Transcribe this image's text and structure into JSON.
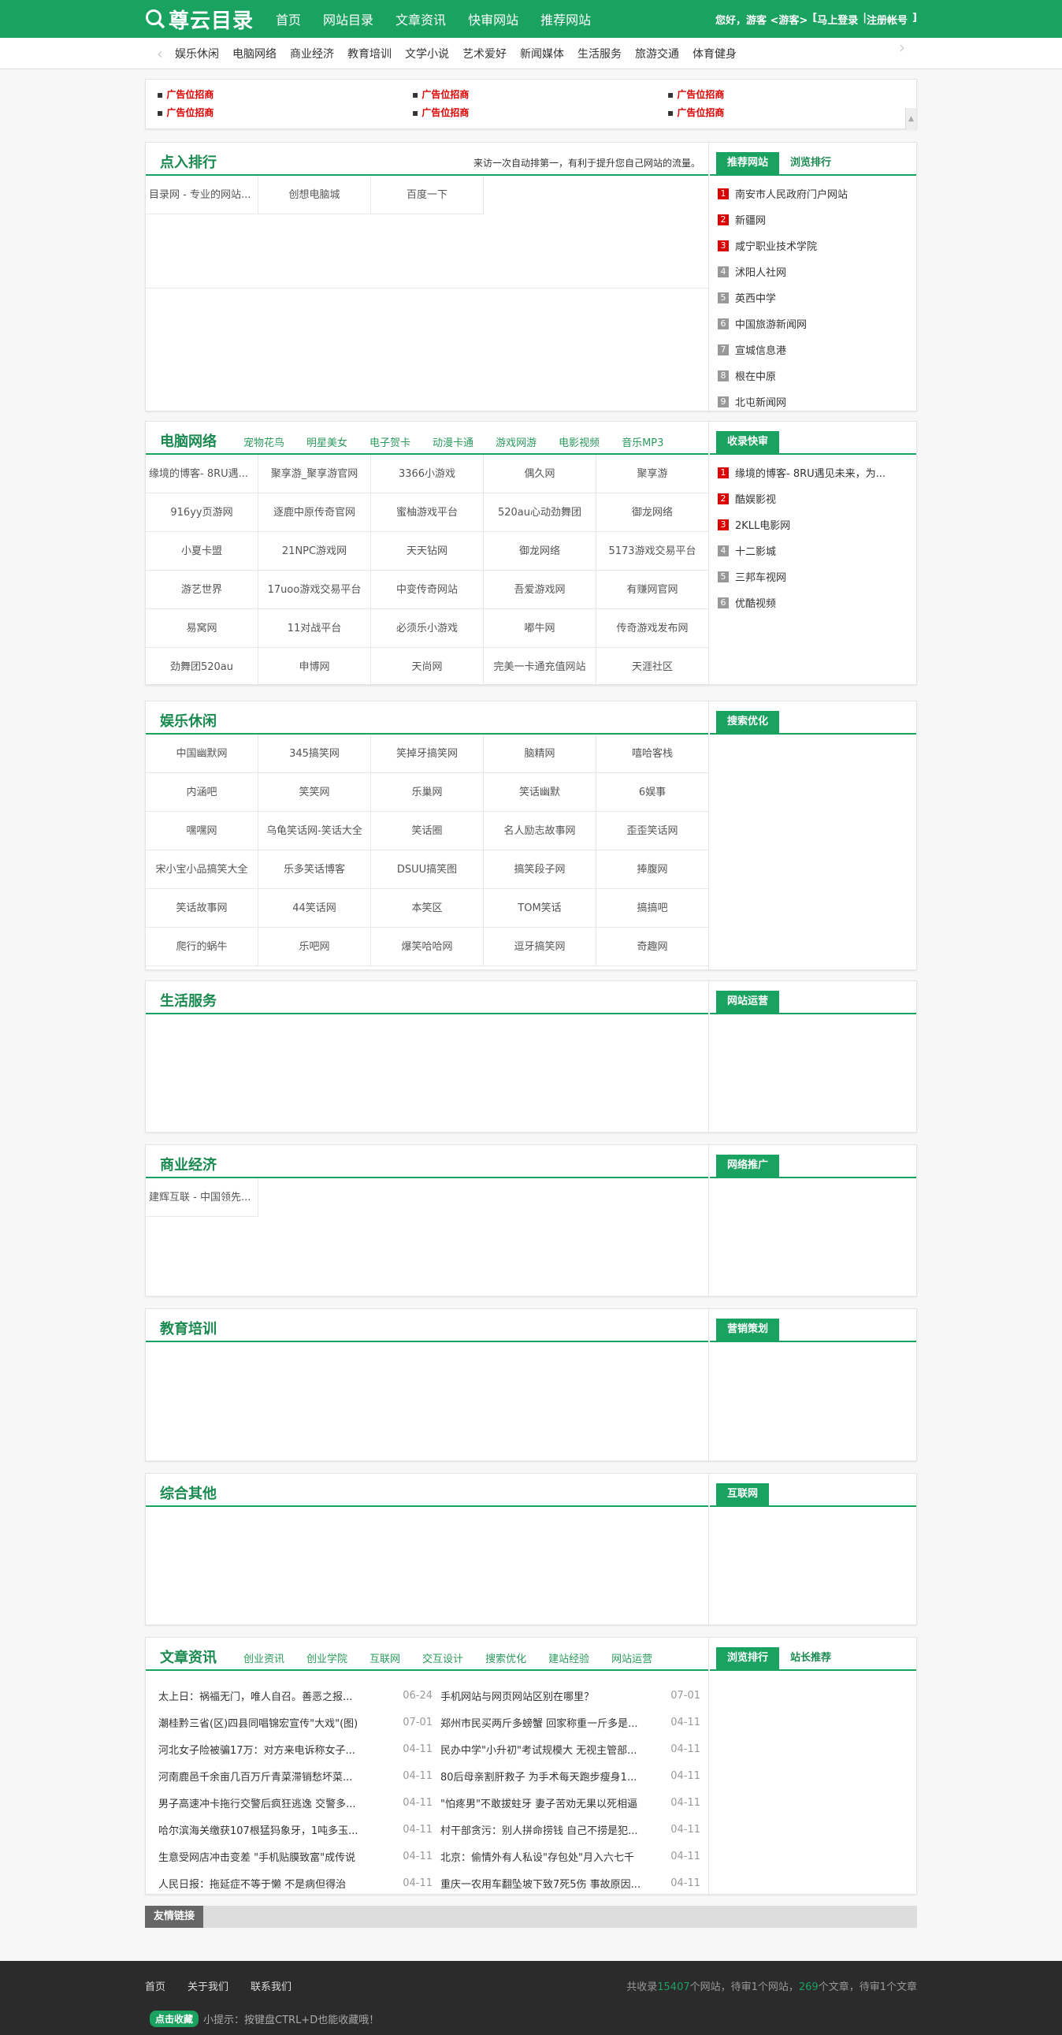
{
  "header": {
    "logo": "尊云目录",
    "nav": [
      "首页",
      "网站目录",
      "文章资讯",
      "快审网站",
      "推荐网站"
    ],
    "greeting": "您好，游客 <游客>",
    "login": "马上登录",
    "register": "注册帐号"
  },
  "subnav": [
    "娱乐休闲",
    "电脑网络",
    "商业经济",
    "教育培训",
    "文学小说",
    "艺术爱好",
    "新闻媒体",
    "生活服务",
    "旅游交通",
    "体育健身"
  ],
  "ads": [
    "广告位招商",
    "广告位招商",
    "广告位招商",
    "广告位招商",
    "广告位招商",
    "广告位招商"
  ],
  "dianru": {
    "title": "点入排行",
    "note": "来访一次自动排第一，有利于提升您自己网站的流量。",
    "sites": [
      "目录网 - 专业的网站...",
      "创想电脑城",
      "百度一下"
    ],
    "tabs": [
      "推荐网站",
      "浏览排行"
    ],
    "rank": [
      "南安市人民政府门户网站",
      "新疆网",
      "咸宁职业技术学院",
      "沭阳人社网",
      "英西中学",
      "中国旅游新闻网",
      "宣城信息港",
      "根在中原",
      "北屯新闻网"
    ]
  },
  "computer": {
    "title": "电脑网络",
    "cats": [
      "宠物花鸟",
      "明星美女",
      "电子贺卡",
      "动漫卡通",
      "游戏网游",
      "电影视频",
      "音乐MP3"
    ],
    "sites": [
      "缘境的博客- 8RU遇...",
      "聚享游_聚享游官网",
      "3366小游戏",
      "偶久网",
      "聚享游",
      "916yy页游网",
      "逐鹿中原传奇官网",
      "蜜柚游戏平台",
      "520au心动劲舞团",
      "御龙网络",
      "小夏卡盟",
      "21NPC游戏网",
      "天天钻网",
      "御龙网络",
      "5173游戏交易平台",
      "游艺世界",
      "17uoo游戏交易平台",
      "中变传奇网站",
      "吾爱游戏网",
      "有赚网官网",
      "易窝网",
      "11对战平台",
      "必须乐小游戏",
      "嘟牛网",
      "传奇游戏发布网",
      "劲舞团520au",
      "申博网",
      "天尚网",
      "完美一卡通充值网站",
      "天涯社区"
    ],
    "rtab": "收录快审",
    "rank": [
      "缘境的博客- 8RU遇见未来，为...",
      "酷娱影视",
      "2KLL电影网",
      "十二影城",
      "三邦车视网",
      "优酷视频"
    ]
  },
  "ent": {
    "title": "娱乐休闲",
    "rtab": "搜索优化",
    "sites": [
      "中国幽默网",
      "345搞笑网",
      "笑掉牙搞笑网",
      "脑精网",
      "嘻哈客栈",
      "内涵吧",
      "笑笑网",
      "乐巢网",
      "笑话幽默",
      "6娱事",
      "嘿嘿网",
      "乌龟笑话网-笑话大全",
      "笑话圈",
      "名人励志故事网",
      "歪歪笑话网",
      "宋小宝小品搞笑大全",
      "乐多笑话博客",
      "DSUU搞笑图",
      "搞笑段子网",
      "捧腹网",
      "笑话故事网",
      "44笑话网",
      "本笑区",
      "TOM笑话",
      "搞搞吧",
      "爬行的蜗牛",
      "乐吧网",
      "爆笑哈哈网",
      "逗牙搞笑网",
      "奇趣网"
    ]
  },
  "life": {
    "title": "生活服务",
    "rtab": "网站运营"
  },
  "biz": {
    "title": "商业经济",
    "rtab": "网络推广",
    "sites": [
      "建辉互联 - 中国领先..."
    ]
  },
  "edu": {
    "title": "教育培训",
    "rtab": "营销策划"
  },
  "other": {
    "title": "综合其他",
    "rtab": "互联网"
  },
  "news": {
    "title": "文章资讯",
    "cats": [
      "创业资讯",
      "创业学院",
      "互联网",
      "交互设计",
      "搜索优化",
      "建站经验",
      "网站运营"
    ],
    "tabs": [
      "浏览排行",
      "站长推荐"
    ],
    "items": [
      [
        "太上日：祸福无门，唯人自召。善恶之报...",
        "06-24"
      ],
      [
        "手机网站与网页网站区别在哪里？",
        "07-01"
      ],
      [
        "潮桂黔三省(区)四县同唱锦宏宣传\"大戏\"(图)",
        "07-01"
      ],
      [
        "郑州市民买两斤多螃蟹 回家称重一斤多是...",
        "04-11"
      ],
      [
        "河北女子险被骗17万：对方来电诉称女子...",
        "04-11"
      ],
      [
        "民办中学\"小升初\"考试规模大 无视主管部...",
        "04-11"
      ],
      [
        "河南鹿邑千余亩几百万斤青菜滞销愁坏菜...",
        "04-11"
      ],
      [
        "80后母亲割肝救子 为手术每天跑步瘦身1...",
        "04-11"
      ],
      [
        "男子高速冲卡拖行交警后疯狂逃逸 交警多...",
        "04-11"
      ],
      [
        "\"怕疼男\"不敢拔蛀牙 妻子苦劝无果以死相逼",
        "04-11"
      ],
      [
        "哈尔滨海关缴获107根猛犸象牙，1吨多玉...",
        "04-11"
      ],
      [
        "村干部贪污：别人拼命捞钱 自己不捞是犯...",
        "04-11"
      ],
      [
        "生意受网店冲击变差 \"手机贴膜致富\"成传说",
        "04-11"
      ],
      [
        "北京：偷情外有人私设\"存包处\"月入六七千",
        "04-11"
      ],
      [
        "人民日报：拖延症不等于懒 不是病但得治",
        "04-11"
      ],
      [
        "重庆一农用车翻坠坡下致7死5伤 事故原因...",
        "04-11"
      ]
    ]
  },
  "friend": "友情链接",
  "footer": {
    "links": [
      "首页",
      "关于我们",
      "联系我们"
    ],
    "stat": {
      "pre": "共收录",
      "sites": "15407",
      "mid1": "个网站，待审1个网站，",
      "arts": "269",
      "mid2": "个文章，待审1个文章"
    },
    "tip_btn": "点击收藏",
    "tip": "小提示：按键盘CTRL+D也能收藏哦！"
  },
  "colors": {
    "brand": "#1aa260",
    "ad": "#dd0000"
  }
}
